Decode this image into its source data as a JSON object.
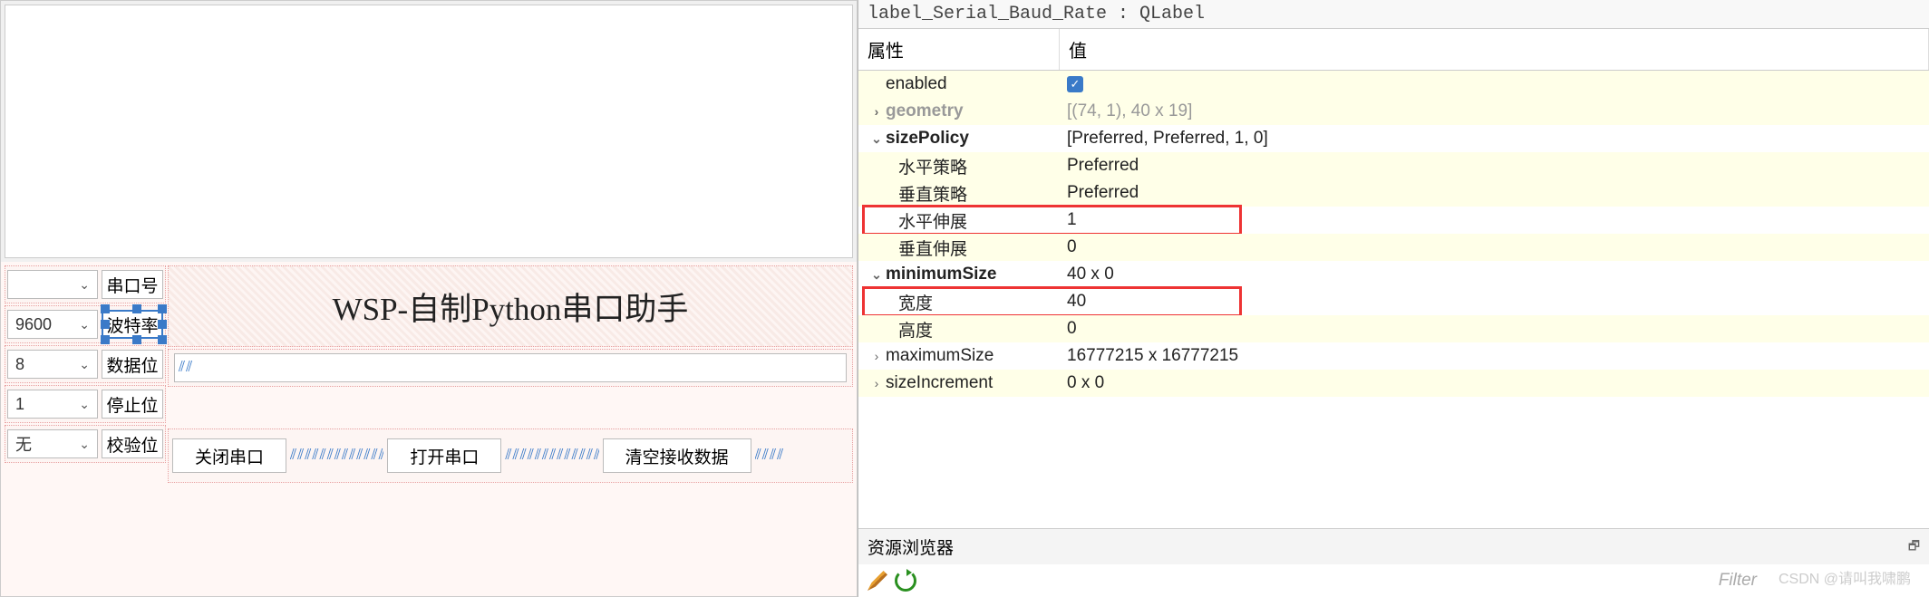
{
  "form": {
    "com_port": {
      "label": "串口号",
      "value": ""
    },
    "baud_rate": {
      "label": "波特率",
      "value": "9600"
    },
    "data_bits": {
      "label": "数据位",
      "value": "8"
    },
    "stop_bits": {
      "label": "停止位",
      "value": "1"
    },
    "parity": {
      "label": "校验位",
      "value": "无"
    },
    "title": "WSP-自制Python串口助手",
    "btn_close": "关闭串口",
    "btn_open": "打开串口",
    "btn_clear": "清空接收数据"
  },
  "inspector": {
    "object_label": "label_Serial_Baud_Rate : QLabel",
    "header_prop": "属性",
    "header_val": "值",
    "rows": {
      "enabled": {
        "name": "enabled"
      },
      "geometry": {
        "name": "geometry",
        "val": "[(74, 1), 40 x 19]"
      },
      "sizePolicy": {
        "name": "sizePolicy",
        "val": "[Preferred, Preferred, 1, 0]"
      },
      "hpolicy": {
        "name": "水平策略",
        "val": "Preferred"
      },
      "vpolicy": {
        "name": "垂直策略",
        "val": "Preferred"
      },
      "hstretch": {
        "name": "水平伸展",
        "val": "1"
      },
      "vstretch": {
        "name": "垂直伸展",
        "val": "0"
      },
      "minsize": {
        "name": "minimumSize",
        "val": "40 x 0"
      },
      "width": {
        "name": "宽度",
        "val": "40"
      },
      "height": {
        "name": "高度",
        "val": "0"
      },
      "maxsize": {
        "name": "maximumSize",
        "val": "16777215 x 16777215"
      },
      "sizeinc": {
        "name": "sizeIncrement",
        "val": "0 x 0"
      }
    }
  },
  "resource_browser": {
    "title": "资源浏览器",
    "filter": "Filter"
  },
  "watermark": "CSDN @请叫我啸鹏"
}
